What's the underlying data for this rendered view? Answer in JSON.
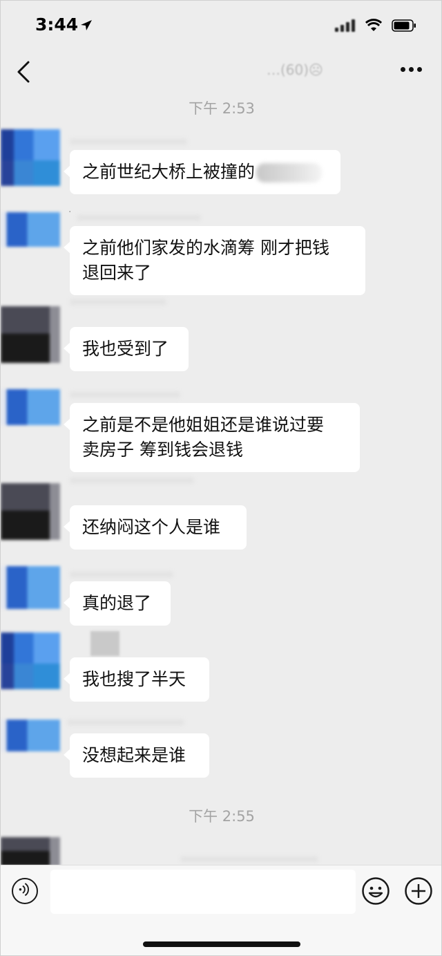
{
  "status_bar": {
    "time": "3:44",
    "icons": [
      "location-arrow-icon",
      "cellular-signal-icon",
      "wifi-icon",
      "battery-icon"
    ]
  },
  "nav": {
    "back_icon": "chevron-left-icon",
    "title": "…(60)☹",
    "more_icon": "more-dots-icon"
  },
  "timestamps": [
    "下午 2:53",
    "下午 2:55"
  ],
  "messages": [
    {
      "avatar": "blue",
      "text_lines": [
        "之前世纪大桥上被撞的"
      ],
      "redacted_tail": true
    },
    {
      "avatar": "blue2",
      "text_lines": [
        "之前他们家发的水滴筹 刚才把钱",
        "退回来了"
      ]
    },
    {
      "avatar": "dark",
      "text_lines": [
        "我也受到了"
      ]
    },
    {
      "avatar": "blue2",
      "text_lines": [
        "之前是不是他姐姐还是谁说过要",
        "卖房子 筹到钱会退钱"
      ]
    },
    {
      "avatar": "dark",
      "text_lines": [
        "还纳闷这个人是谁"
      ]
    },
    {
      "avatar": "blue2",
      "text_lines": [
        "真的退了"
      ]
    },
    {
      "avatar": "blue",
      "text_lines": [
        "我也搜了半天"
      ]
    },
    {
      "avatar": "blue2",
      "text_lines": [
        "没想起来是谁"
      ]
    }
  ],
  "input_bar": {
    "voice_icon": "voice-icon",
    "emoji_icon": "emoji-icon",
    "plus_icon": "plus-circle-icon",
    "placeholder": ""
  },
  "colors": {
    "background": "#ededed",
    "bubble": "#ffffff",
    "timestamp": "#a3a3a3"
  }
}
